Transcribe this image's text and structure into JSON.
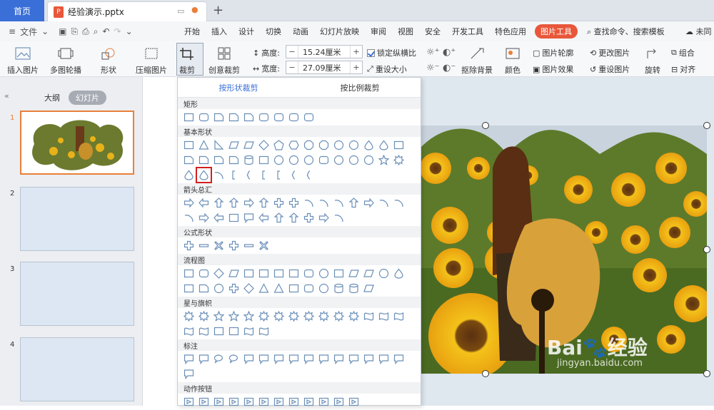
{
  "tabs": {
    "home": "首页",
    "doc_name": "经验演示.pptx"
  },
  "menu": {
    "file": "文件",
    "items": [
      "开始",
      "插入",
      "设计",
      "切换",
      "动画",
      "幻灯片放映",
      "审阅",
      "视图",
      "安全",
      "开发工具",
      "特色应用",
      "图片工具"
    ],
    "active": "图片工具",
    "search": "查找命令、搜索模板",
    "cloud": "未同"
  },
  "ribbon": {
    "insert_picture": "插入图片",
    "multi_outline": "多图轮播",
    "shape": "形状",
    "compress": "压缩图片",
    "crop": "裁剪",
    "creative_crop": "创意裁剪",
    "height_label": "高度:",
    "height_value": "15.24厘米",
    "width_label": "宽度:",
    "width_value": "27.09厘米",
    "lock_ratio": "锁定纵横比",
    "reset_size": "重设大小",
    "remove_bg": "抠除背景",
    "color": "颜色",
    "pic_outline": "图片轮廓",
    "pic_effect": "图片效果",
    "change_pic": "更改图片",
    "reset_pic": "重设图片",
    "rotate": "旋转",
    "group": "组合",
    "align": "对齐"
  },
  "pane": {
    "outline": "大纲",
    "slides": "幻灯片",
    "slide_numbers": [
      "1",
      "2",
      "3",
      "4"
    ]
  },
  "dropdown": {
    "tab_shape": "按形状裁剪",
    "tab_ratio": "按比例裁剪",
    "sections": [
      "矩形",
      "基本形状",
      "箭头总汇",
      "公式形状",
      "流程图",
      "星与旗帜",
      "标注",
      "动作按钮"
    ]
  },
  "watermark": {
    "brand": "Bai",
    "brand2": "经验",
    "url": "jingyan.baidu.com"
  },
  "colors": {
    "accent": "#e8573a",
    "home_tab": "#3a6fd8",
    "selected_shape_outline": "#d41f1f"
  }
}
